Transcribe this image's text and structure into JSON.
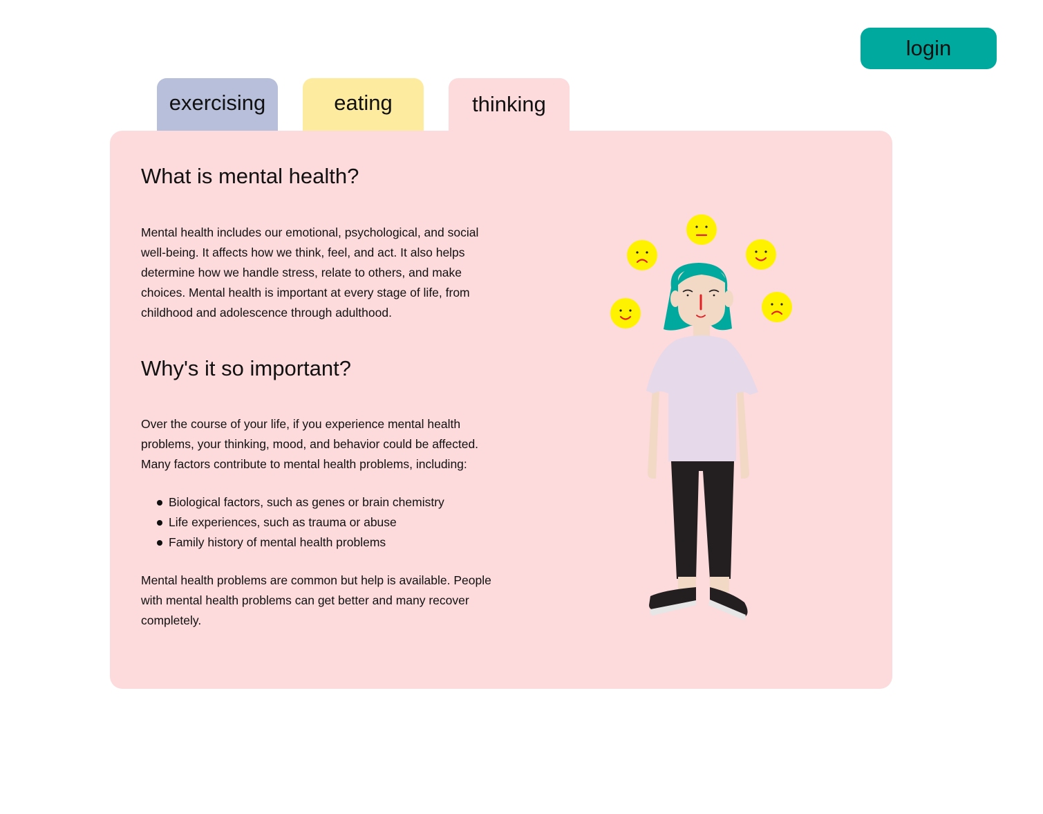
{
  "header": {
    "login_label": "login"
  },
  "tabs": [
    {
      "label": "exercising",
      "color": "#b7bfda"
    },
    {
      "label": "eating",
      "color": "#fdeb9f"
    },
    {
      "label": "thinking",
      "color": "#fddadb",
      "active": true
    }
  ],
  "content": {
    "what_heading": "What is mental health?",
    "what_body": "Mental health includes our emotional, psychological, and social well-being. It affects how we think, feel, and act. It also helps determine how we handle stress, relate to others, and make choices. Mental health is important at every stage of life, from childhood and adolescence through adulthood.",
    "why_heading": "Why's it so important?",
    "why_body": "Over the course of your life, if you experience mental health problems, your thinking, mood, and behavior could be affected. Many factors contribute to mental health problems, including:",
    "factors": [
      "Biological factors, such as genes or brain chemistry",
      "Life experiences, such as trauma or abuse",
      "Family history of mental health problems"
    ],
    "closing_body": "Mental health problems are common but help is available. People with mental health problems can get better and many recover completely."
  },
  "illustration": {
    "icon": "person-with-mood-faces-icon",
    "colors": {
      "face_yellow": "#fff200",
      "hair_teal": "#00a99d",
      "shirt_lilac": "#e6d9ea",
      "skin": "#f1d9c5",
      "pants": "#231f20"
    }
  },
  "colors": {
    "accent": "#00a99d",
    "panel": "#fddadb"
  }
}
